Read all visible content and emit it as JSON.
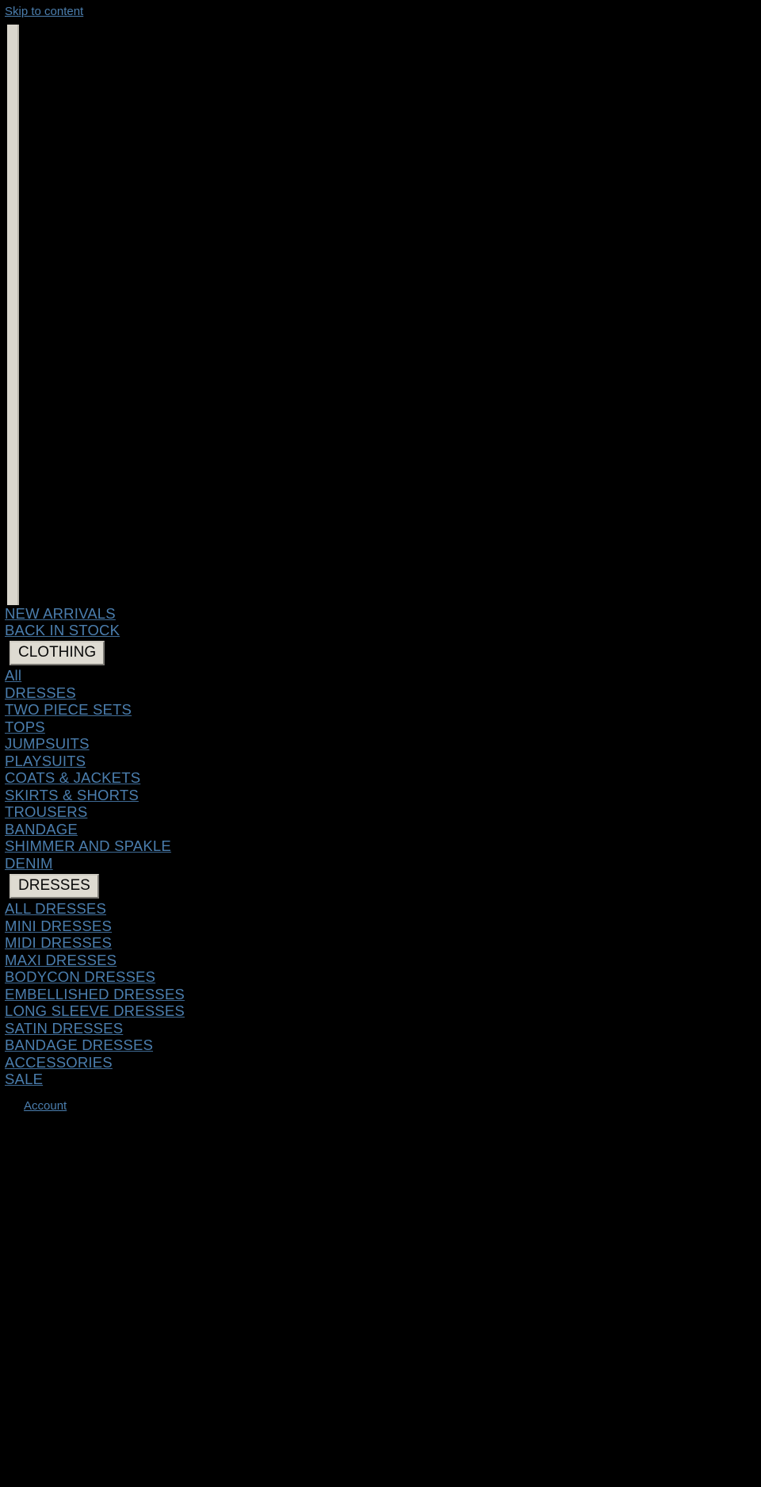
{
  "page": {
    "background_color": "#000000",
    "link_color": "#4b7eae",
    "button_background_color": "#dedbd2",
    "button_text_color": "#0a0a0a",
    "logo_placeholder_color": "#d9d6cd"
  },
  "skip": {
    "label": "Skip to content"
  },
  "logo": {
    "alt": ""
  },
  "nav": {
    "top_links": [
      {
        "label": "NEW ARRIVALS"
      },
      {
        "label": "BACK IN STOCK"
      }
    ],
    "sections": [
      {
        "button_label": "CLOTHING",
        "items": [
          {
            "label": "All"
          },
          {
            "label": "DRESSES"
          },
          {
            "label": "TWO PIECE SETS"
          },
          {
            "label": "TOPS"
          },
          {
            "label": "JUMPSUITS"
          },
          {
            "label": "PLAYSUITS"
          },
          {
            "label": "COATS & JACKETS"
          },
          {
            "label": "SKIRTS & SHORTS"
          },
          {
            "label": "TROUSERS"
          },
          {
            "label": "BANDAGE"
          },
          {
            "label": "SHIMMER AND SPAKLE"
          },
          {
            "label": "DENIM"
          }
        ]
      },
      {
        "button_label": "DRESSES",
        "items": [
          {
            "label": "ALL DRESSES"
          },
          {
            "label": "MINI DRESSES"
          },
          {
            "label": "MIDI DRESSES"
          },
          {
            "label": "MAXI DRESSES"
          },
          {
            "label": "BODYCON DRESSES"
          },
          {
            "label": "EMBELLISHED DRESSES"
          },
          {
            "label": "LONG SLEEVE DRESSES"
          },
          {
            "label": "SATIN DRESSES"
          },
          {
            "label": "BANDAGE DRESSES"
          }
        ]
      }
    ],
    "bottom_links": [
      {
        "label": "ACCESSORIES"
      },
      {
        "label": "SALE"
      }
    ]
  },
  "utility": {
    "links": [
      {
        "label": "Account"
      }
    ]
  }
}
